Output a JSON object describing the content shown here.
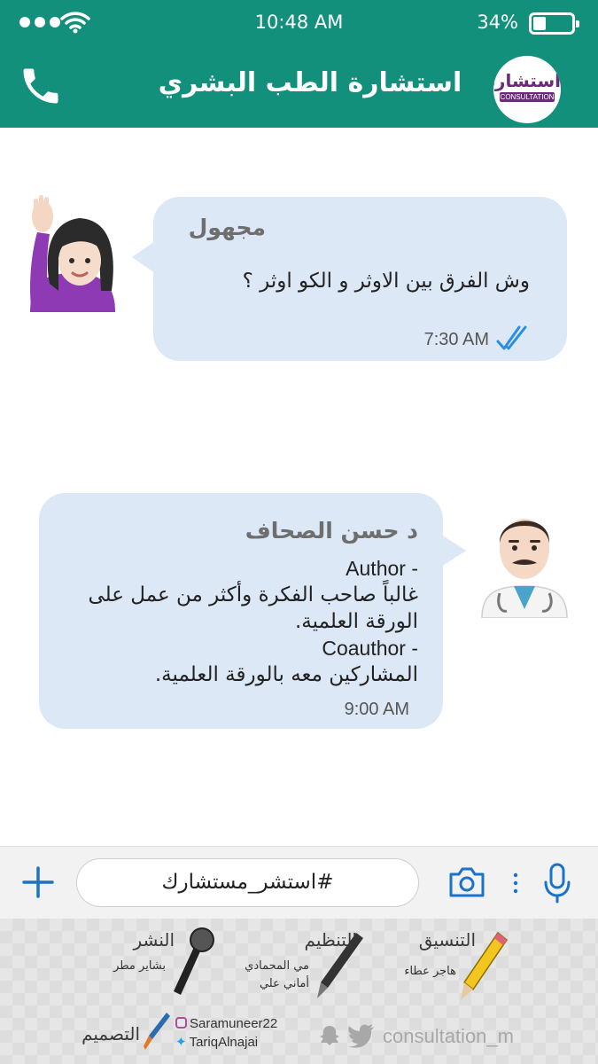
{
  "status_bar": {
    "time": "10:48 AM",
    "battery": "34%",
    "battery_level": 0.34
  },
  "header": {
    "title": "استشارة الطب البشري",
    "logo_text": "استشارة",
    "logo_subtext": "CONSULTATION"
  },
  "messages": [
    {
      "sender": "مجهول",
      "text": "وش الفرق بين الاوثر و الكو اوثر ؟",
      "time": "7:30 AM",
      "read": true
    },
    {
      "sender": "د حسن الصحاف",
      "lines": [
        "Author -",
        "غالباً صاحب الفكرة وأكثر من عمل على",
        "الورقة العلمية.",
        "Coauthor -",
        "المشاركين معه بالورقة العلمية."
      ],
      "time": "9:00 AM"
    }
  ],
  "input": {
    "value": "#استشر_مستشارك"
  },
  "credits": {
    "publishing": {
      "role": "النشر",
      "names": [
        "بشاير مطر"
      ]
    },
    "organizing": {
      "role": "التنظيم",
      "names": [
        "مي المحمادي",
        "أماني علي"
      ]
    },
    "coordination": {
      "role": "التنسيق",
      "names": [
        "هاجر عطاء"
      ]
    },
    "design": {
      "role": "التصميم"
    },
    "instagram": "Saramuneer22",
    "twitter": "TariqAlnajai",
    "brand_handle": "consultation_m"
  },
  "colors": {
    "header": "#12907c",
    "bubble": "#dde8f6",
    "icon_blue": "#1a73c8"
  }
}
